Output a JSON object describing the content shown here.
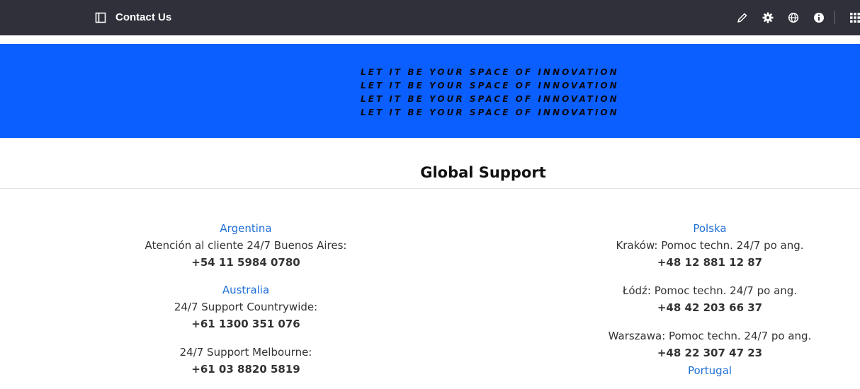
{
  "topbar": {
    "title": "Contact Us",
    "icons": [
      "sidebar-panel-icon",
      "pencil-icon",
      "gear-icon",
      "globe-icon",
      "info-icon",
      "apps-grid-icon"
    ]
  },
  "banner": {
    "lines": [
      "LET IT BE YOUR SPACE OF INNOVATION",
      "LET IT BE YOUR SPACE OF INNOVATION",
      "LET IT BE YOUR SPACE OF INNOVATION",
      "LET IT BE YOUR SPACE OF INNOVATION"
    ],
    "background": "#0b5fff"
  },
  "section": {
    "title": "Global Support"
  },
  "left_column": {
    "argentina": {
      "country": "Argentina",
      "entries": [
        {
          "label": "Atención al cliente 24/7 Buenos Aires:",
          "phone": "+54 11 5984 0780"
        }
      ]
    },
    "australia": {
      "country": "Australia",
      "entries": [
        {
          "label": "24/7 Support Countrywide:",
          "phone": "+61 1300 351 076"
        },
        {
          "label": "24/7 Support Melbourne:",
          "phone": "+61 03 8820 5819"
        }
      ]
    }
  },
  "right_column": {
    "polska": {
      "country": "Polska",
      "entries": [
        {
          "label": "Kraków: Pomoc techn. 24/7 po ang.",
          "phone": "+48 12 881 12 87"
        },
        {
          "label": "Łódź: Pomoc techn. 24/7 po ang.",
          "phone": "+48 42 203 66 37"
        },
        {
          "label": "Warszawa: Pomoc techn. 24/7 po ang.",
          "phone": "+48 22 307 47 23"
        }
      ]
    },
    "portugal": {
      "country": "Portugal"
    }
  },
  "colors": {
    "topbar": "#2f3039",
    "link": "#1f6fd6",
    "text": "#333333"
  }
}
